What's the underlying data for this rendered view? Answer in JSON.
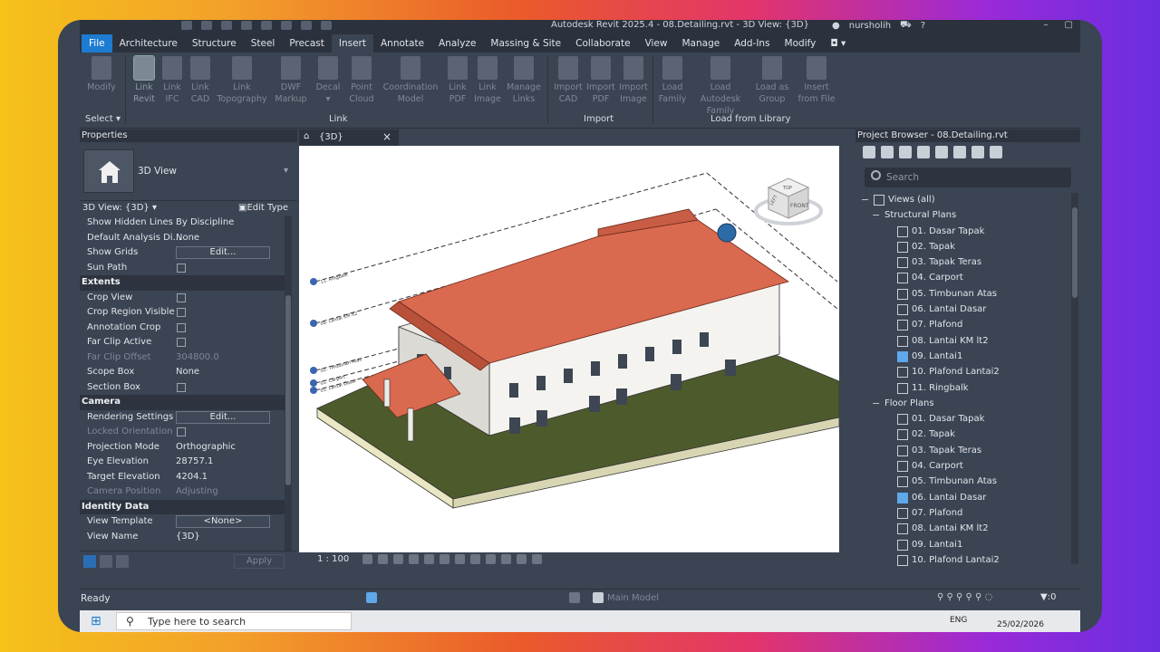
{
  "window": {
    "title": "Autodesk Revit 2025.4 - 08.Detailing.rvt - 3D View: {3D}",
    "user": "nursholih"
  },
  "menu": {
    "tabs": [
      "File",
      "Architecture",
      "Structure",
      "Steel",
      "Precast",
      "Insert",
      "Annotate",
      "Analyze",
      "Massing & Site",
      "Collaborate",
      "View",
      "Manage",
      "Add-Ins",
      "Modify"
    ],
    "active": "Insert"
  },
  "ribbon": {
    "select_label": "Select",
    "buttons": {
      "modify": "Modify",
      "link_revit_1": "Link",
      "link_revit_2": "Revit",
      "link_ifc_1": "Link",
      "link_ifc_2": "IFC",
      "link_cad_1": "Link",
      "link_cad_2": "CAD",
      "link_topo_1": "Link",
      "link_topo_2": "Topography",
      "dwf_1": "DWF",
      "dwf_2": "Markup",
      "decal": "Decal",
      "pc_1": "Point",
      "pc_2": "Cloud",
      "coord_1": "Coordination",
      "coord_2": "Model",
      "lpdf_1": "Link",
      "lpdf_2": "PDF",
      "limg_1": "Link",
      "limg_2": "Image",
      "mlinks_1": "Manage",
      "mlinks_2": "Links",
      "icad_1": "Import",
      "icad_2": "CAD",
      "ipdf_1": "Import",
      "ipdf_2": "PDF",
      "iimg_1": "Import",
      "iimg_2": "Image",
      "lfam_1": "Load",
      "lfam_2": "Family",
      "lad_1": "Load Autodesk",
      "lad_2": "Family",
      "lgrp_1": "Load as",
      "lgrp_2": "Group",
      "ins_1": "Insert",
      "ins_2": "from File"
    },
    "groups": {
      "link": "Link",
      "import": "Import",
      "load": "Load from Library"
    }
  },
  "properties": {
    "title": "Properties",
    "type_name": "3D View",
    "instance_label": "3D View: {3D}",
    "edit_type": "Edit Type",
    "rows": [
      {
        "k": "Show Hidden Lines",
        "v": "By Discipline"
      },
      {
        "k": "Default Analysis Di...",
        "v": "None"
      },
      {
        "k": "Show Grids",
        "btn": "Edit..."
      },
      {
        "k": "Sun Path",
        "cb": true
      },
      {
        "section": "Extents"
      },
      {
        "k": "Crop View",
        "cb": true
      },
      {
        "k": "Crop Region Visible",
        "cb": true
      },
      {
        "k": "Annotation Crop",
        "cb": true
      },
      {
        "k": "Far Clip Active",
        "cb": true
      },
      {
        "k": "Far Clip Offset",
        "v": "304800.0",
        "dim": true
      },
      {
        "k": "Scope Box",
        "v": "None"
      },
      {
        "k": "Section Box",
        "cb": true
      },
      {
        "section": "Camera"
      },
      {
        "k": "Rendering Settings",
        "btn": "Edit..."
      },
      {
        "k": "Locked Orientation",
        "cb": true,
        "dim": true
      },
      {
        "k": "Projection Mode",
        "v": "Orthographic"
      },
      {
        "k": "Eye Elevation",
        "v": "28757.1"
      },
      {
        "k": "Target Elevation",
        "v": "4204.1"
      },
      {
        "k": "Camera Position",
        "v": "Adjusting",
        "dim": true
      },
      {
        "section": "Identity Data"
      },
      {
        "k": "View Template",
        "btn": "<None>"
      },
      {
        "k": "View Name",
        "v": "{3D}"
      }
    ],
    "apply": "Apply"
  },
  "view": {
    "tab_label": "{3D}",
    "scale": "1 : 100",
    "cube_top": "TOP",
    "cube_left": "LEFT",
    "cube_front": "FRONT",
    "levels": [
      "11. Ringbalk",
      "08. Lantai KM lt2",
      "02. Timbunan Atas",
      "01. Carport",
      "01. Lantai Dasar"
    ]
  },
  "browser": {
    "title": "Project Browser - 08.Detailing.rvt",
    "search_placeholder": "Search",
    "root": "Views (all)",
    "structural_label": "Structural Plans",
    "structural": [
      "01. Dasar Tapak",
      "02. Tapak",
      "03. Tapak Teras",
      "04. Carport",
      "05. Timbunan Atas",
      "06. Lantai Dasar",
      "07. Plafond",
      "08. Lantai KM lt2",
      "09. Lantai1",
      "10. Plafond Lantai2",
      "11. Ringbalk"
    ],
    "structural_active": 8,
    "floor_label": "Floor Plans",
    "floor": [
      "01. Dasar Tapak",
      "02. Tapak",
      "03. Tapak Teras",
      "04. Carport",
      "05. Timbunan Atas",
      "06. Lantai Dasar",
      "07. Plafond",
      "08. Lantai KM lt2",
      "09. Lantai1",
      "10. Plafond Lantai2"
    ],
    "floor_active": 5
  },
  "status": {
    "text": "Ready",
    "model": "Main Model",
    "filter_count": ":0"
  },
  "taskbar": {
    "search": "Type here to search",
    "lang": "ENG",
    "date": "25/02/2026"
  },
  "colors": {
    "accent": "#1d7bd1",
    "roof": "#d9694f",
    "ground": "#4a5a2a"
  }
}
